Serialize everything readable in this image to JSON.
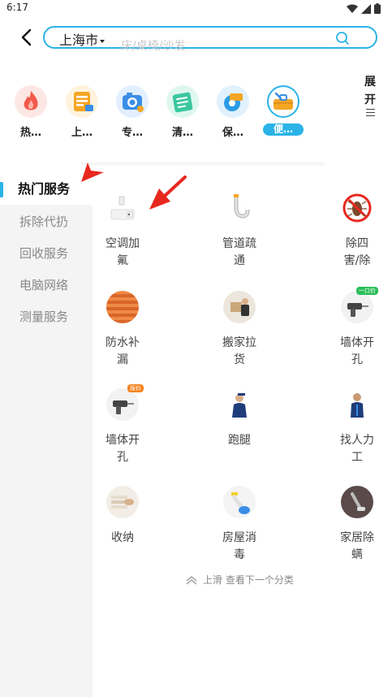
{
  "status_bar": {
    "time": "6:17"
  },
  "header": {
    "city": "上海市",
    "search_placeholder": "床/桌椅/沙发"
  },
  "categories": [
    {
      "label": "热…",
      "icon": "fire-icon",
      "color": "#f25a4a"
    },
    {
      "label": "上…",
      "icon": "doc-icon",
      "color": "#f5a623"
    },
    {
      "label": "专…",
      "icon": "camera-icon",
      "color": "#3a8ee6"
    },
    {
      "label": "清…",
      "icon": "clean-icon",
      "color": "#3cc7a0"
    },
    {
      "label": "保…",
      "icon": "repair-icon",
      "color": "#2b9ce6"
    },
    {
      "label": "便…",
      "icon": "toolbox-icon",
      "color": "#f5a623",
      "active": true
    }
  ],
  "expand": {
    "label_line1": "展",
    "label_line2": "开"
  },
  "sidebar": {
    "items": [
      {
        "label": "热门服务",
        "active": true
      },
      {
        "label": "拆除代扔"
      },
      {
        "label": "回收服务"
      },
      {
        "label": "电脑网络"
      },
      {
        "label": "测量服务"
      }
    ]
  },
  "services": [
    {
      "line1": "空调加",
      "line2": "氟",
      "icon": "aircon-icon"
    },
    {
      "line1": "管道疏",
      "line2": "通",
      "icon": "pipe-icon"
    },
    {
      "line1": "除四",
      "line2": "害/除",
      "icon": "pest-icon"
    },
    {
      "line1": "防水补",
      "line2": "漏",
      "icon": "waterproof-icon"
    },
    {
      "line1": "搬家拉",
      "line2": "货",
      "icon": "moving-icon"
    },
    {
      "line1": "墙体开",
      "line2": "孔",
      "icon": "drill-icon",
      "badge": "一口价"
    },
    {
      "line1": "墙体开",
      "line2": "孔",
      "icon": "drill-icon",
      "badge": "报价"
    },
    {
      "line1": "跑腿",
      "line2": "",
      "icon": "courier-icon"
    },
    {
      "line1": "找人力",
      "line2": "工",
      "icon": "worker-icon"
    },
    {
      "line1": "收纳",
      "line2": "",
      "icon": "storage-icon"
    },
    {
      "line1": "房屋消",
      "line2": "毒",
      "icon": "disinfect-icon"
    },
    {
      "line1": "家居除",
      "line2": "螨",
      "icon": "mite-icon"
    }
  ],
  "scroll_hint": "上滑 查看下一个分类",
  "colors": {
    "accent": "#2bb3e8",
    "annotation_arrow": "#e8281f"
  }
}
